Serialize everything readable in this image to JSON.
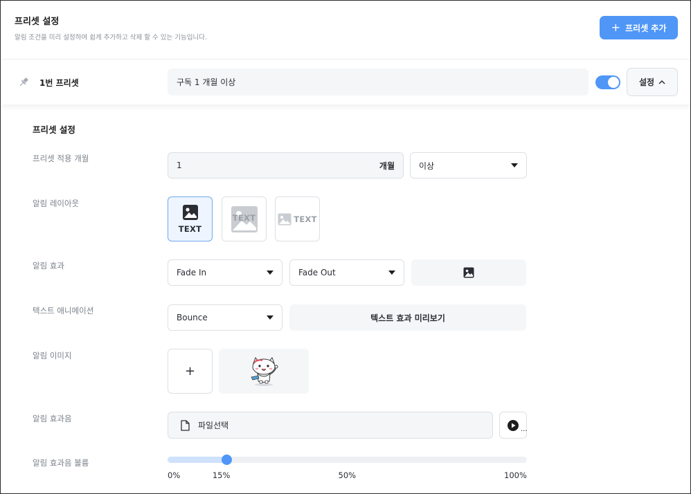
{
  "header": {
    "title": "프리셋 설정",
    "description": "알림 조건을 미리 설정하여 쉽게 추가하고 삭제 할 수 있는 기능입니다.",
    "add_button": "프리셋 추가"
  },
  "preset": {
    "name": "1번 프리셋",
    "condition": "구독 1 개월 이상",
    "enabled": true,
    "settings_button": "설정"
  },
  "settings": {
    "section_title": "프리셋 설정",
    "months": {
      "label": "프리셋 적용 개월",
      "value": "1",
      "unit": "개월",
      "comparator": "이상"
    },
    "layout": {
      "label": "알림 레이아웃",
      "options": [
        "TEXT",
        "TEXT",
        "TEXT"
      ],
      "selected_index": 0
    },
    "effect": {
      "label": "알림 효과",
      "in": "Fade In",
      "out": "Fade Out"
    },
    "text_animation": {
      "label": "텍스트 애니메이션",
      "value": "Bounce",
      "preview_button": "텍스트 효과 미리보기"
    },
    "image": {
      "label": "알림 이미지",
      "add_symbol": "+"
    },
    "sound": {
      "label": "알림 효과음",
      "file_button": "파일선택"
    },
    "volume": {
      "label": "알림 효과음 볼륨",
      "value_percent": 15,
      "ticks": [
        {
          "label": "0%",
          "value": 0
        },
        {
          "label": "15%",
          "value": 15
        },
        {
          "label": "50%",
          "value": 50
        },
        {
          "label": "100%",
          "value": 100
        }
      ]
    }
  },
  "colors": {
    "accent": "#4f96f7",
    "field_bg": "#f5f6f8",
    "border": "#dcdfe4"
  }
}
